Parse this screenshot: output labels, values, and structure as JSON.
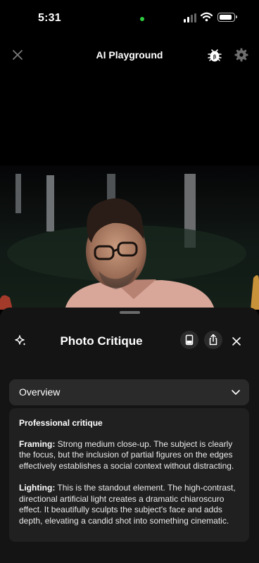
{
  "status_bar": {
    "time": "5:31",
    "battery_level": 0.9
  },
  "nav": {
    "title": "AI Playground",
    "close_icon": "close-icon",
    "bug_icon": "bug-icon",
    "settings_icon": "gear-icon"
  },
  "sheet": {
    "title": "Photo Critique",
    "icons": [
      "sparkle-icon",
      "phone-frame-icon",
      "share-icon",
      "close-icon"
    ],
    "overview": {
      "label": "Overview"
    },
    "critique": {
      "heading": "Professional critique",
      "paragraphs": [
        {
          "label": "Framing:",
          "text": " Strong medium close-up. The subject is clearly the focus, but the inclusion of partial figures on the edges effectively establishes a social context without distracting."
        },
        {
          "label": "Lighting:",
          "text": " This is the standout element. The high-contrast, directional artificial light creates a dramatic chiaroscuro effect. It beautifully sculpts the subject's face and adds depth, elevating a candid shot into something cinematic."
        }
      ]
    }
  },
  "colors": {
    "sheet_bg": "#141414",
    "card_bg": "#202020",
    "overview_bg": "#2a2a2a",
    "status_green": "#2ecc40"
  }
}
